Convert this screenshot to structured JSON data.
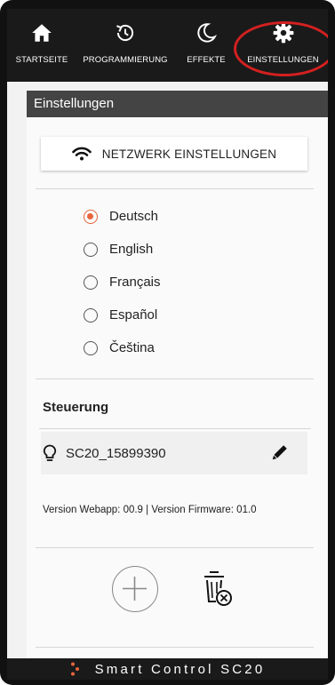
{
  "nav": {
    "items": [
      {
        "label": "STARTSEITE",
        "icon": "home-icon"
      },
      {
        "label": "PROGRAMMIERUNG",
        "icon": "history-icon"
      },
      {
        "label": "EFFEKTE",
        "icon": "moon-icon"
      },
      {
        "label": "EINSTELLUNGEN",
        "icon": "gear-icon"
      }
    ],
    "active": "EINSTELLUNGEN"
  },
  "section_title": "Einstellungen",
  "network_button": {
    "label": "NETZWERK EINSTELLUNGEN",
    "icon": "wifi-icon"
  },
  "languages": {
    "options": [
      "Deutsch",
      "English",
      "Français",
      "Español",
      "Čeština"
    ],
    "selected": "Deutsch"
  },
  "control": {
    "title": "Steuerung",
    "device_name": "SC20_15899390",
    "device_icon": "bulb-icon",
    "edit_icon": "pencil-icon"
  },
  "version_text": "Version Webapp: 00.9 | Version Firmware: 01.0",
  "actions": {
    "add_icon": "plus-circle-icon",
    "delete_icon": "trash-icon"
  },
  "footer": {
    "brand": "Smart Control SC20"
  },
  "colors": {
    "accent": "#e8643c",
    "highlight": "#d42020",
    "nav_bg": "#1a1a1a",
    "header_bg": "#444444"
  }
}
